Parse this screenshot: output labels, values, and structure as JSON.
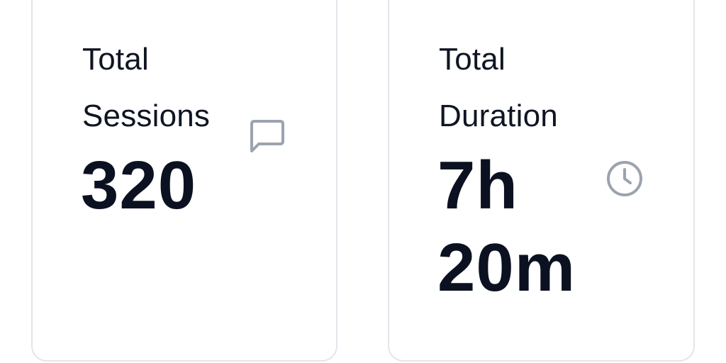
{
  "cards": [
    {
      "label_line1": "Total",
      "label_line2": "Sessions",
      "value": "320",
      "icon": "message-square-icon"
    },
    {
      "label_line1": "Total",
      "label_line2": "Duration",
      "value_line1": "7h",
      "value_line2": "20m",
      "icon": "clock-icon"
    }
  ],
  "colors": {
    "card_border": "#e2e5ea",
    "text_primary": "#0f1522",
    "icon_gray": "#9ca3af"
  }
}
